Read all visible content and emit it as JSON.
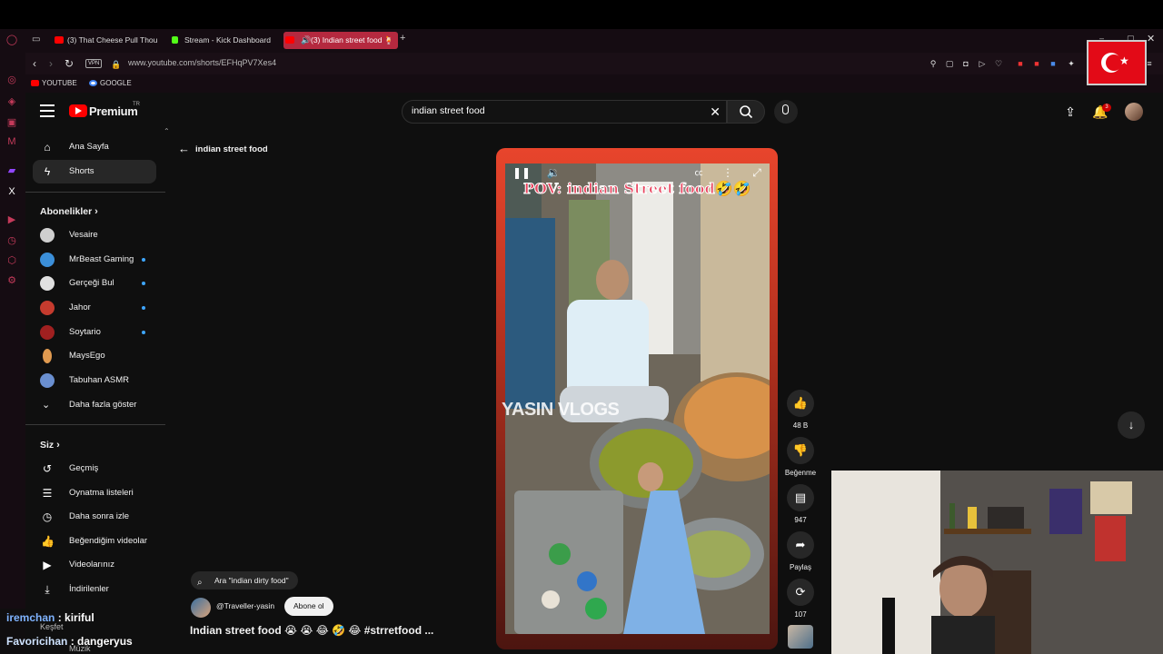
{
  "browser": {
    "tabs": [
      {
        "label": "(3) That Cheese Pull Thou",
        "color": "#ff0000"
      },
      {
        "label": "Stream - Kick Dashboard",
        "color": "#53fc18"
      },
      {
        "label": "(3) Indian street food 🍹",
        "color": "#ff0000",
        "active": true
      }
    ],
    "add_tab": "+",
    "vpn": "VPN",
    "url": "www.youtube.com/shorts/EFHqPV7Xes4",
    "bookmarks": [
      {
        "label": "YOUTUBE",
        "color": "#ff0000"
      },
      {
        "label": "GOOGLE",
        "color": "#4285f4"
      }
    ]
  },
  "header": {
    "logo": "Premium",
    "logo_region": "TR",
    "search_value": "indian street food",
    "notification_count": "3"
  },
  "sidebar": {
    "main": [
      {
        "label": "Ana Sayfa",
        "icon": "home-icon"
      },
      {
        "label": "Shorts",
        "icon": "shorts-icon",
        "active": true
      }
    ],
    "subscriptions_title": "Abonelikler",
    "subscriptions": [
      {
        "label": "Vesaire",
        "color": "#cfcfcf",
        "dot": false
      },
      {
        "label": "MrBeast Gaming",
        "color": "#3b8fd9",
        "dot": true
      },
      {
        "label": "Gerçeği Bul",
        "color": "#e0e0e0",
        "dot": true
      },
      {
        "label": "Jahor",
        "color": "#c53b2e",
        "dot": true
      },
      {
        "label": "Soytario",
        "color": "#a02020",
        "dot": true
      },
      {
        "label": "MaysEgo",
        "color": "#e09a50",
        "dot": false
      },
      {
        "label": "Tabuhan ASMR",
        "color": "#6a8fd0",
        "dot": false
      }
    ],
    "show_more": "Daha fazla göster",
    "you_title": "Siz",
    "you_items": [
      {
        "label": "Geçmiş",
        "icon": "history-icon"
      },
      {
        "label": "Oynatma listeleri",
        "icon": "playlist-icon"
      },
      {
        "label": "Daha sonra izle",
        "icon": "clock-icon"
      },
      {
        "label": "Beğendiğim videolar",
        "icon": "like-icon"
      },
      {
        "label": "Videolarınız",
        "icon": "video-icon"
      },
      {
        "label": "İndirilenler",
        "icon": "download-icon"
      }
    ],
    "explore_title": "Keşfet",
    "music_label": "Müzik"
  },
  "shorts": {
    "back_label": "indian street food",
    "overlay_text": "POV: indian Street food🤣🤣",
    "watermark": "YASIN VLOGS",
    "search_suggestion": "Ara \"indian dirty food\"",
    "channel": "@Traveller-yasin",
    "subscribe_label": "Abone ol",
    "title": "Indian street food 😭 😭 😂 🤣 😂 #strretfood ...",
    "actions": [
      {
        "label": "48 B",
        "icon": "thumbs-up-icon"
      },
      {
        "label": "Beğenme",
        "icon": "thumbs-down-icon"
      },
      {
        "label": "947",
        "icon": "comment-icon"
      },
      {
        "label": "Paylaş",
        "icon": "share-icon"
      },
      {
        "label": "107",
        "icon": "remix-icon"
      }
    ]
  },
  "chat": [
    {
      "user": "iremchan",
      "message": ": kiriful"
    },
    {
      "user": "Favoricihan",
      "message": ": dangeryus"
    }
  ]
}
